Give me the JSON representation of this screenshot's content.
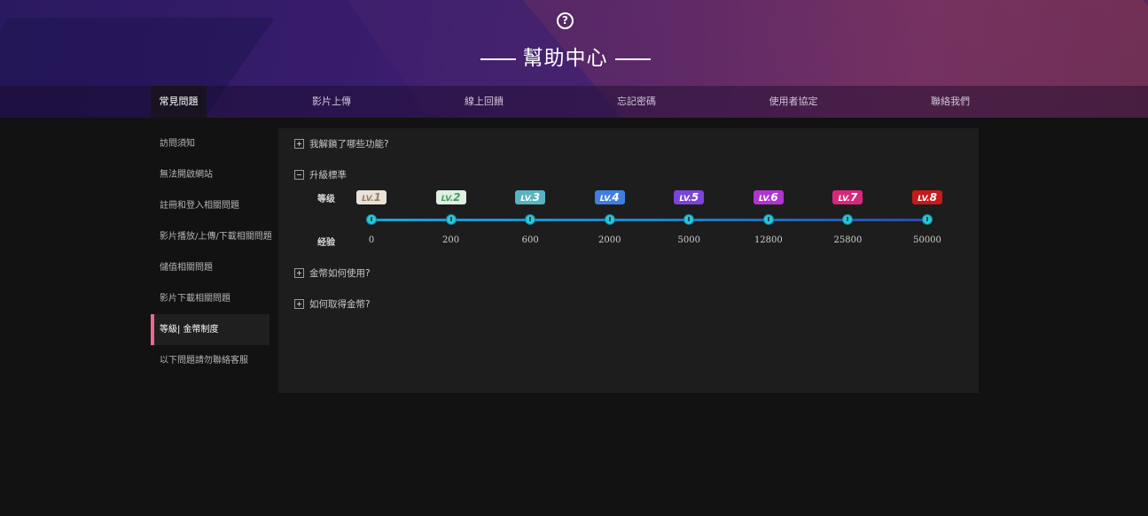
{
  "header": {
    "title": "幫助中心",
    "help_icon": "question-circle-icon"
  },
  "nav": {
    "tabs": [
      {
        "label": "常見問題",
        "active": true
      },
      {
        "label": "影片上傳",
        "active": false
      },
      {
        "label": "線上回饋",
        "active": false
      },
      {
        "label": "忘記密碼",
        "active": false
      },
      {
        "label": "使用者協定",
        "active": false
      },
      {
        "label": "聯絡我們",
        "active": false
      }
    ]
  },
  "sidebar": {
    "items": [
      {
        "label": "訪問須知",
        "active": false
      },
      {
        "label": "無法開啟網站",
        "active": false
      },
      {
        "label": "註冊和登入相關問題",
        "active": false
      },
      {
        "label": "影片播放/上傳/下載相關問題",
        "active": false
      },
      {
        "label": "儲值相關問題",
        "active": false
      },
      {
        "label": "影片下載相關問題",
        "active": false
      },
      {
        "label": "等級| 金幣制度",
        "active": true
      },
      {
        "label": "以下問題請勿聯絡客服",
        "active": false
      }
    ],
    "accent_color": "#e86a8e"
  },
  "faq": {
    "items": [
      {
        "label": "我解鎖了哪些功能?",
        "expanded": false
      },
      {
        "label": "升級標準",
        "expanded": true
      },
      {
        "label": "金幣如何使用?",
        "expanded": false
      },
      {
        "label": "如何取得金幣?",
        "expanded": false
      }
    ],
    "level_table": {
      "level_label": "等级",
      "exp_label": "经验",
      "levels": [
        {
          "prefix": "LV.",
          "num": "1",
          "exp": "0",
          "color": "#e9e2d8",
          "text_color": "#9a7d60"
        },
        {
          "prefix": "LV.",
          "num": "2",
          "exp": "200",
          "color": "#dff0e2",
          "text_color": "#4a9a64"
        },
        {
          "prefix": "LV.",
          "num": "3",
          "exp": "600",
          "color": "#58b4c0",
          "text_color": "#ffffff"
        },
        {
          "prefix": "LV.",
          "num": "4",
          "exp": "2000",
          "color": "#3f7fe0",
          "text_color": "#ffffff"
        },
        {
          "prefix": "LV.",
          "num": "5",
          "exp": "5000",
          "color": "#7a45d8",
          "text_color": "#ffffff"
        },
        {
          "prefix": "LV.",
          "num": "6",
          "exp": "12800",
          "color": "#b035d0",
          "text_color": "#ffffff"
        },
        {
          "prefix": "LV.",
          "num": "7",
          "exp": "25800",
          "color": "#d8277a",
          "text_color": "#ffffff"
        },
        {
          "prefix": "LV.",
          "num": "8",
          "exp": "50000",
          "color": "#c41a1a",
          "text_color": "#ffffff"
        }
      ]
    }
  }
}
